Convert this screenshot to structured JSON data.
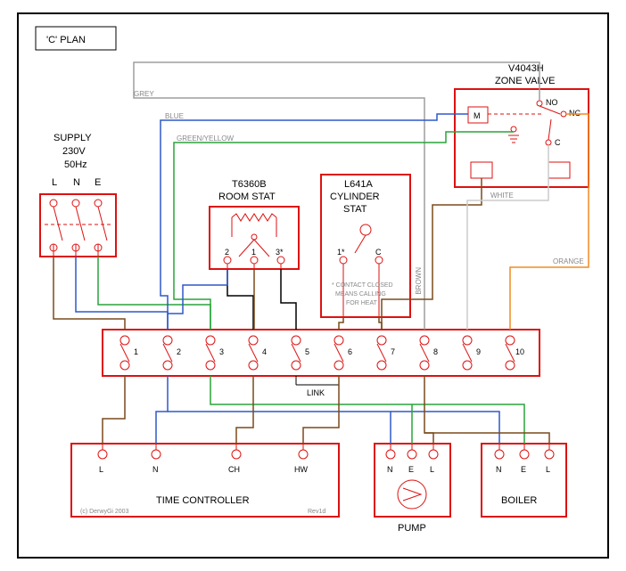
{
  "title": "'C' PLAN",
  "supply": {
    "label": "SUPPLY",
    "voltage": "230V",
    "freq": "50Hz",
    "terminals": [
      "L",
      "N",
      "E"
    ]
  },
  "roomstat": {
    "type": "T6360B",
    "name": "ROOM STAT",
    "terminals": [
      "2",
      "1",
      "3*"
    ]
  },
  "cylstat": {
    "type": "L641A",
    "name": "CYLINDER",
    "name2": "STAT",
    "terminals": [
      "1*",
      "C"
    ],
    "note1": "* CONTACT CLOSED",
    "note2": "MEANS CALLING",
    "note3": "FOR HEAT"
  },
  "zonevalve": {
    "type": "V4043H",
    "name": "ZONE VALVE",
    "m": "M",
    "no": "NO",
    "nc": "NC",
    "c": "C"
  },
  "junction": {
    "terminals": [
      "1",
      "2",
      "3",
      "4",
      "5",
      "6",
      "7",
      "8",
      "9",
      "10"
    ],
    "link": "LINK"
  },
  "timer": {
    "name": "TIME CONTROLLER",
    "terminals": [
      "L",
      "N",
      "CH",
      "HW"
    ]
  },
  "pump": {
    "name": "PUMP",
    "terminals": [
      "N",
      "E",
      "L"
    ]
  },
  "boiler": {
    "name": "BOILER",
    "terminals": [
      "N",
      "E",
      "L"
    ]
  },
  "wirelabels": {
    "grey": "GREY",
    "blue": "BLUE",
    "greenyellow": "GREEN/YELLOW",
    "brown": "BROWN",
    "white": "WHITE",
    "orange": "ORANGE"
  },
  "rev": "Rev1d",
  "copy": "(c) DerwyGi 2003"
}
